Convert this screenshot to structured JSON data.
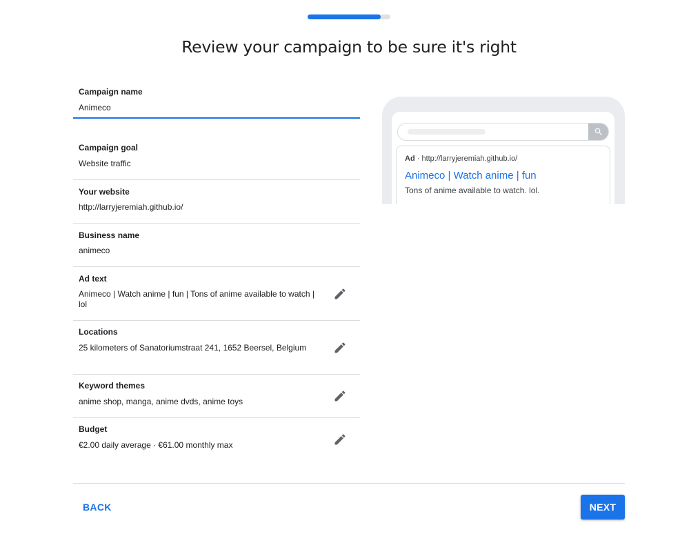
{
  "progress": {
    "value": 0.88
  },
  "title": "Review your campaign to be sure it's right",
  "campaign_name": {
    "label": "Campaign name",
    "value": "Animeco"
  },
  "rows": [
    {
      "label": "Campaign goal",
      "value": "Website traffic"
    },
    {
      "label": "Your website",
      "value": "http://larryjeremiah.github.io/"
    },
    {
      "label": "Business name",
      "value": "animeco"
    },
    {
      "label": "Ad text",
      "value": "Animeco | Watch anime | fun | Tons of anime available to watch | lol"
    },
    {
      "label": "Locations",
      "value": "25 kilometers of Sanatoriumstraat 241, 1652 Beersel, Belgium"
    },
    {
      "label": "Keyword themes",
      "value": "anime shop, manga, anime dvds, anime toys"
    },
    {
      "label": "Budget",
      "value": "€2.00 daily average · €61.00 monthly max"
    }
  ],
  "preview": {
    "ad_label": "Ad",
    "ad_separator": " · ",
    "display_url": "http://larryjeremiah.github.io/",
    "headline": "Animeco | Watch anime | fun",
    "description": "Tons of anime available to watch. lol."
  },
  "footer": {
    "back_label": "BACK",
    "next_label": "NEXT"
  },
  "colors": {
    "accent": "#1a73e8",
    "text": "#202124",
    "divider": "#dadce0",
    "icon": "#5f6368"
  },
  "icons": {
    "edit": "pencil-icon",
    "search": "search-icon"
  }
}
